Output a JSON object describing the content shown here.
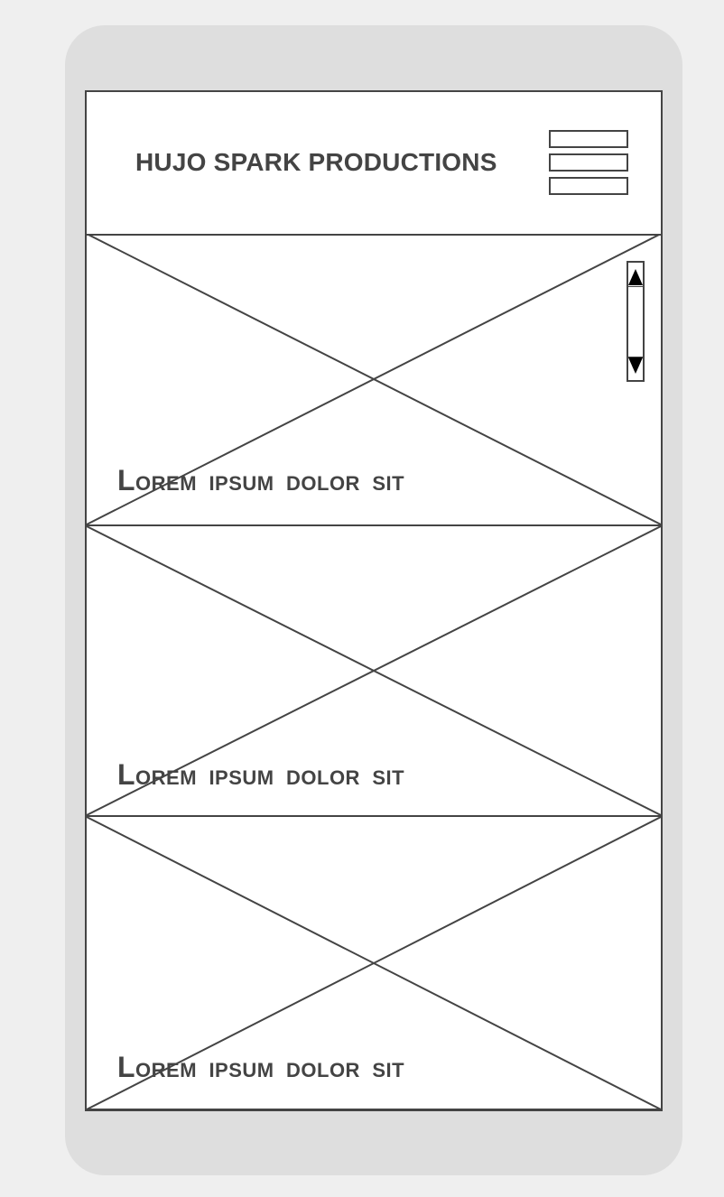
{
  "header": {
    "title": "HUJO SPARK PRODUCTIONS",
    "menu_icon": "hamburger-menu-icon"
  },
  "panels": [
    {
      "caption": "Lorem ipsum dolor sit"
    },
    {
      "caption": "Lorem ipsum dolor sit"
    },
    {
      "caption": "Lorem ipsum dolor sit"
    }
  ],
  "scrollbar": {
    "up_icon": "arrow-up-icon",
    "down_icon": "arrow-down-icon"
  },
  "colors": {
    "stroke": "#444444",
    "phone_frame": "#dedede",
    "page_background": "#efefef"
  }
}
